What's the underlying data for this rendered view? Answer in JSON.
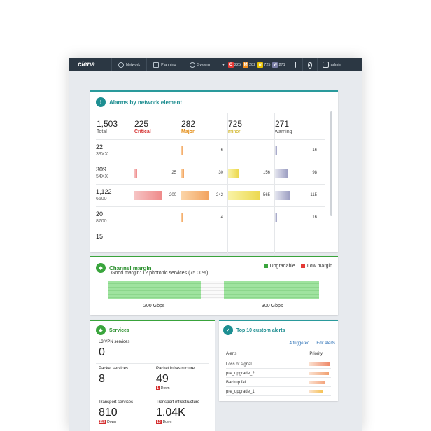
{
  "topbar": {
    "logo": "ciena",
    "nav": [
      {
        "label": "Network",
        "icon": "globe-icon"
      },
      {
        "label": "Planning",
        "icon": "planning-icon"
      },
      {
        "label": "System",
        "icon": "gear-icon"
      }
    ],
    "severity": [
      {
        "letter": "C",
        "count": "225",
        "color": "#e53935"
      },
      {
        "letter": "M",
        "count": "282",
        "color": "#f08c1a"
      },
      {
        "letter": "m",
        "count": "725",
        "color": "#e8c100"
      },
      {
        "letter": "w",
        "count": "271",
        "color": "#7a7fa6"
      }
    ],
    "help": "?",
    "user": "admin"
  },
  "alarms": {
    "title": "Alarms by network element",
    "totals": [
      {
        "value": "1,503",
        "label": "Total"
      },
      {
        "value": "225",
        "label": "Critical"
      },
      {
        "value": "282",
        "label": "Major"
      },
      {
        "value": "725",
        "label": "minor"
      },
      {
        "value": "271",
        "label": "warning"
      }
    ],
    "rows": [
      {
        "value": "22",
        "type": "39XX",
        "critical": "",
        "major": "6",
        "minor": "",
        "warning": "16",
        "bars": [
          0,
          0.03,
          0,
          0.06
        ]
      },
      {
        "value": "309",
        "type": "54XX",
        "critical": "25",
        "major": "30",
        "minor": "156",
        "warning": "98",
        "bars": [
          0.08,
          0.07,
          0.3,
          0.36
        ]
      },
      {
        "value": "1,122",
        "type": "6500",
        "critical": "200",
        "major": "242",
        "minor": "565",
        "warning": "115",
        "bars": [
          0.77,
          0.8,
          0.92,
          0.42
        ]
      },
      {
        "value": "20",
        "type": "8700",
        "critical": "",
        "major": "4",
        "minor": "",
        "warning": "16",
        "bars": [
          0,
          0.02,
          0,
          0.06
        ]
      },
      {
        "value": "15",
        "type": "",
        "critical": "",
        "major": "",
        "minor": "",
        "warning": "",
        "bars": [
          0,
          0,
          0,
          0
        ]
      }
    ]
  },
  "channel": {
    "title": "Channel margin",
    "summary": "Good margin: 12 photonic services (75.00%)",
    "legend": [
      {
        "label": "Upgradable",
        "color": "#3aa53d"
      },
      {
        "label": "Low margin",
        "color": "#e53935"
      }
    ],
    "segments": [
      {
        "kind": "good",
        "fraction": 0.44
      },
      {
        "kind": "empty",
        "fraction": 0.11
      },
      {
        "kind": "good",
        "fraction": 0.45
      }
    ],
    "labels": [
      "200 Gbps",
      "300 Gbps"
    ]
  },
  "services": {
    "title": "Services",
    "l3vpn": {
      "label": "L3 VPN services",
      "value": "0"
    },
    "packet_services": {
      "label": "Packet services",
      "value": "8"
    },
    "packet_infra": {
      "label": "Packet infrastructure",
      "value": "49",
      "down": "1",
      "down_label": "Down"
    },
    "transport_services": {
      "label": "Transport services",
      "value": "810",
      "down": "113",
      "down_label": "Down"
    },
    "transport_infra": {
      "label": "Transport infrastructure",
      "value": "1.04K",
      "down": "13",
      "down_label": "Down"
    }
  },
  "alerts": {
    "title": "Top 10 custom alerts",
    "triggered": "4 triggered",
    "edit": "Edit alerts",
    "col_alerts": "Alerts",
    "col_priority": "Priority",
    "items": [
      {
        "name": "Loss of signal",
        "priority": 1.0,
        "color": "#ef8a6a"
      },
      {
        "name": "pre_upgrade_2",
        "priority": 0.95,
        "color": "#f1a070"
      },
      {
        "name": "Backup fail",
        "priority": 0.8,
        "color": "#f3a27a"
      },
      {
        "name": "pre_upgrade_1",
        "priority": 0.7,
        "color": "#f5c150"
      }
    ]
  }
}
